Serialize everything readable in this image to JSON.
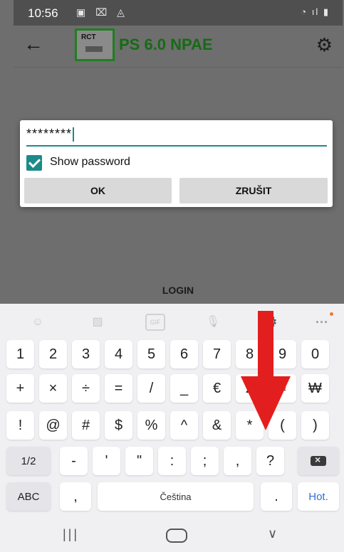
{
  "statusbar": {
    "time": "10:56",
    "icons": [
      "picture-icon",
      "message-icon",
      "alert-icon"
    ],
    "right_icons": "wifi signal battery"
  },
  "appbar": {
    "title": "PS 6.0 NPAE",
    "logo_text": "RCT"
  },
  "page": {
    "login_label": "LOGIN"
  },
  "dialog": {
    "password_value": "********",
    "show_password_label": "Show password",
    "show_password_checked": true,
    "ok_label": "OK",
    "cancel_label": "ZRUŠIT"
  },
  "keyboard": {
    "toolbar": [
      "emoji-icon",
      "sticker-icon",
      "GIF",
      "mic-icon",
      "settings-icon",
      "more-icon"
    ],
    "rows": [
      [
        "1",
        "2",
        "3",
        "4",
        "5",
        "6",
        "7",
        "8",
        "9",
        "0"
      ],
      [
        "+",
        "×",
        "÷",
        "=",
        "/",
        "_",
        "€",
        "£",
        "¥",
        "₩"
      ],
      [
        "!",
        "@",
        "#",
        "$",
        "%",
        "^",
        "&",
        "*",
        "(",
        ")"
      ]
    ],
    "row4": {
      "shift": "1/2",
      "keys": [
        "-",
        "'",
        "\"",
        ":",
        ";",
        ",",
        "?"
      ]
    },
    "row5": {
      "abc": "ABC",
      "comma": ",",
      "space": "Čeština",
      "period": ".",
      "action": "Hot."
    }
  },
  "colors": {
    "accent": "#1d8a8a",
    "title_green": "#166b16",
    "arrow_red": "#e31e1e"
  }
}
